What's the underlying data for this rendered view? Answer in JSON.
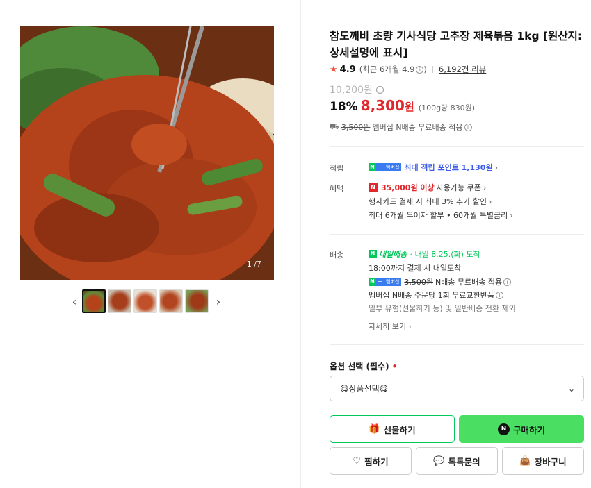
{
  "gallery": {
    "counter_current": "1",
    "counter_total": "/7",
    "prev": "‹",
    "next": "›"
  },
  "product": {
    "title": "참도깨비 초량 기사식당 고추장 제육볶음 1kg [원산지:상세설명에 표시]",
    "rating_score": "4.9",
    "rating_recent": "(최근 6개월 4.9",
    "reviews": "6,192건 리뷰",
    "original_price": "10,200원",
    "discount_pct": "18%",
    "price": "8,300",
    "price_won": "원",
    "unit_price": "(100g당 830원)",
    "ship_strike": "3,500원",
    "ship_note": "멤버십 N배송 무료배송 적용"
  },
  "benefits": {
    "points_label": "적립",
    "points_text": "최대 적립 포인트 1,130원",
    "benefit_label": "혜택",
    "coupon_amount": "35,000원 이상",
    "coupon_text": "사용가능 쿠폰",
    "card_text": "행사카드 결제 시 최대 3% 추가 할인",
    "installment_text": "최대 6개월 무이자 할부 • 60개월 특별금리"
  },
  "delivery": {
    "label": "배송",
    "badge": "내일배송",
    "arrival": "· 내일 8.25.(화) 도착",
    "cutoff": "18:00까지 결제 시 내일도착",
    "ship_strike": "3,500원",
    "ship_note": "N배송 무료배송 적용",
    "exchange": "멤버십 N배송 주문당 1회 무료교환반품",
    "exclusion": "일부 유형(선물하기 등) 및 일반배송 전환 제외",
    "more": "자세히 보기"
  },
  "options": {
    "label": "옵션 선택 (필수)",
    "required_dot": "•",
    "selected": "😋상품선택😋"
  },
  "buttons": {
    "gift": "선물하기",
    "buy": "구매하기",
    "wish": "찜하기",
    "talk": "톡톡문의",
    "cart": "장바구니"
  },
  "colors": {
    "accent_green": "#03c75a",
    "buy_green": "#4ade63",
    "price_red": "#e0272b",
    "points_blue": "#3b5be8"
  }
}
